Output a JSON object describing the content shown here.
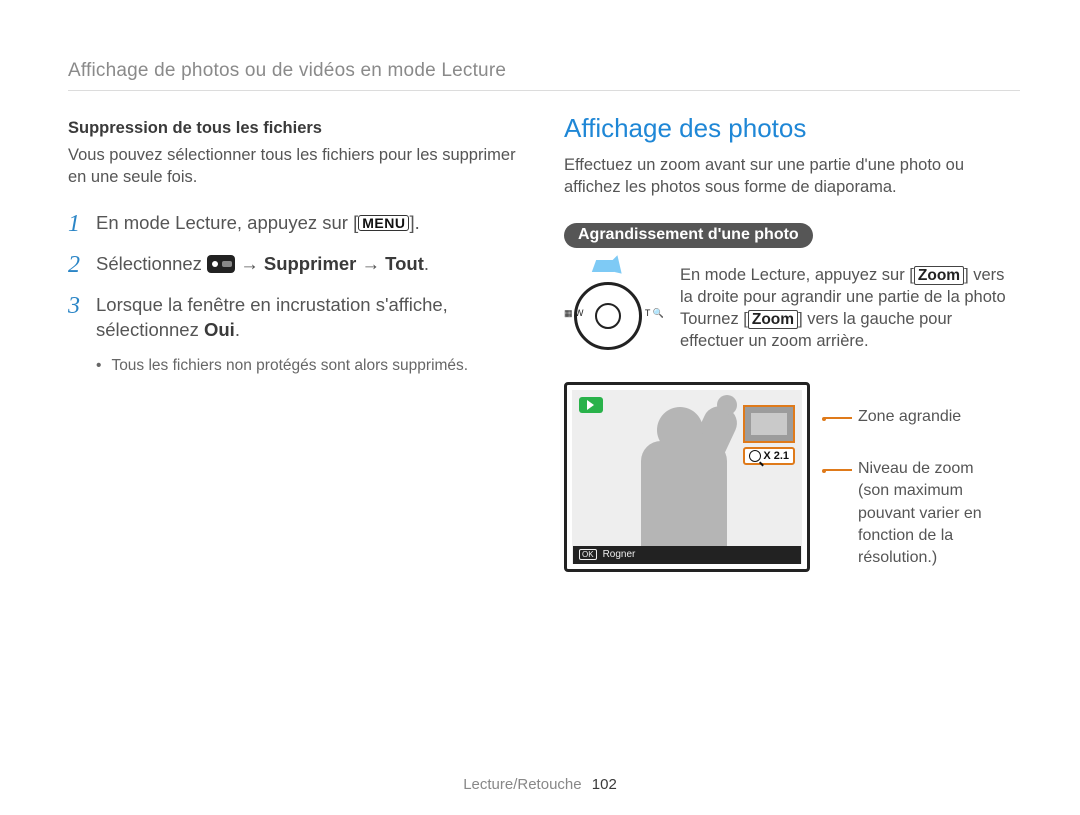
{
  "header": "Affichage de photos ou de vidéos en mode Lecture",
  "left": {
    "subhead": "Suppression de tous les fichiers",
    "intro": "Vous pouvez sélectionner tous les fichiers pour les supprimer en une seule fois.",
    "step1_a": "En mode Lecture, appuyez sur [",
    "menu_label": "MENU",
    "step1_b": "].",
    "step2_a": "Sélectionnez ",
    "step2_arrow": " → ",
    "step2_sup": "Supprimer",
    "step2_tout": "Tout",
    "step2_end": ".",
    "step3_a": "Lorsque la fenêtre en incrustation s'affiche, sélectionnez ",
    "step3_oui": "Oui",
    "step3_end": ".",
    "bullet": "Tous les fichiers non protégés sont alors supprimés."
  },
  "right": {
    "title": "Affichage des photos",
    "intro": "Effectuez un zoom avant sur une partie d'une photo ou affichez les photos sous forme de diaporama.",
    "pill": "Agrandissement d'une photo",
    "zoom_a": "En mode Lecture, appuyez sur [",
    "zoom_kw": "Zoom",
    "zoom_b": "] vers la droite pour agrandir une partie de la photo Tournez [",
    "zoom_c": "] vers la gauche pour effectuer un zoom arrière.",
    "dial_left": "W",
    "dial_left_icon": "▦",
    "dial_right": "T",
    "dial_right_icon": "🔍",
    "zoom_value": "X 2.1",
    "ok_label": "OK",
    "ok_text": "Rogner",
    "callout1": "Zone agrandie",
    "callout2a": "Niveau de zoom",
    "callout2b": "(son maximum pouvant varier en fonction de la résolution.)"
  },
  "footer": {
    "section": "Lecture/Retouche",
    "page": "102"
  }
}
